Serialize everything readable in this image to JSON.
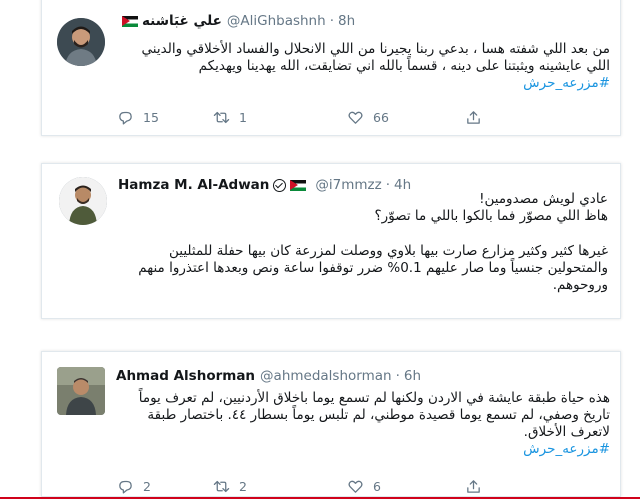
{
  "tweets": [
    {
      "name": "علي غبَاشنه",
      "handle": "@AliGhbashnh",
      "time": "8h",
      "lines": [
        "من بعد اللي شفته هسا ، بدعي ربنا يجيرنا من اللي الانحلال والفساد الأخلاقي والديني",
        "اللي عايشينه ويثبتنا على دينه ، قسماً بالله اني تضايقت، الله يهدينا ويهديكم"
      ],
      "hashtag": "#مزرعه_حرش",
      "replies": "15",
      "retweets": "1",
      "likes": "66"
    },
    {
      "name": "Hamza M. Al-Adwan",
      "handle": "@i7mmzz",
      "time": "4h",
      "lines": [
        "عادي لويش مصدومين!",
        "هاظ اللي مصوّر فما بالكوا باللي ما تصوّر؟"
      ],
      "lines2": [
        "غيرها كثير وكثير مزارع صارت بيها بلاوي ووصلت لمزرعة كان بيها حفلة للمثليين",
        "والمتحولين جنسياً وما صار عليهم 0.1% ضرر توقفوا ساعة ونص وبعدها اعتذروا منهم",
        "وروحوهم."
      ]
    },
    {
      "name": "Ahmad Alshorman",
      "handle": "@ahmedalshorman",
      "time": "6h",
      "lines": [
        "هذه حياة طبقة عايشة في الاردن ولكنها لم تسمع يوما باخلاق الأردنيين، لم تعرف يوماً",
        "تاريخ وصفي، لم تسمع يوما قصيدة موطني، لم تلبس يوماً بسطار ٤٤. باختصار طبقة",
        "لاتعرف الأخلاق."
      ],
      "hashtag": "#مزرعه_حرش",
      "replies": "2",
      "retweets": "2",
      "likes": "6"
    }
  ],
  "icons": {
    "reply": "reply-icon",
    "retweet": "retweet-icon",
    "like": "heart-icon",
    "share": "share-icon",
    "flag": "jordan-flag-icon",
    "verified": "verified-icon"
  },
  "colors": {
    "link": "#1b95e0",
    "muted": "#657786",
    "text": "#14171a",
    "border": "#e1e8ed",
    "bottom_line": "#d0021b"
  }
}
